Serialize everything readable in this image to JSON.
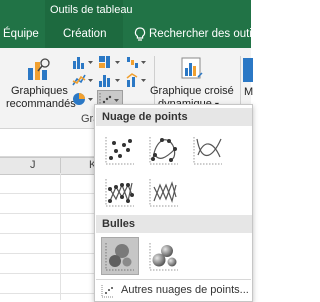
{
  "ribbon_tabs": {
    "context_group": "Outils de tableau",
    "equipe": "Équipe",
    "creation": "Création",
    "search": "Rechercher des outils a"
  },
  "ribbon": {
    "recommended_line1": "Graphiques",
    "recommended_line2": "recommandés",
    "group_label_partial": "Gra",
    "pivot_line1": "Graphique croisé",
    "pivot_line2": "dynamique",
    "pivot_arrow": "▾",
    "maps_partial": "M"
  },
  "sheet": {
    "columns": [
      "J",
      "K"
    ]
  },
  "dropdown": {
    "section_scatter": "Nuage de points",
    "section_bubbles": "Bulles",
    "more_charts": "Autres nuages de points..."
  },
  "colors": {
    "ribbon_green": "#217346",
    "selected_thumb": "#c6c6c6"
  }
}
